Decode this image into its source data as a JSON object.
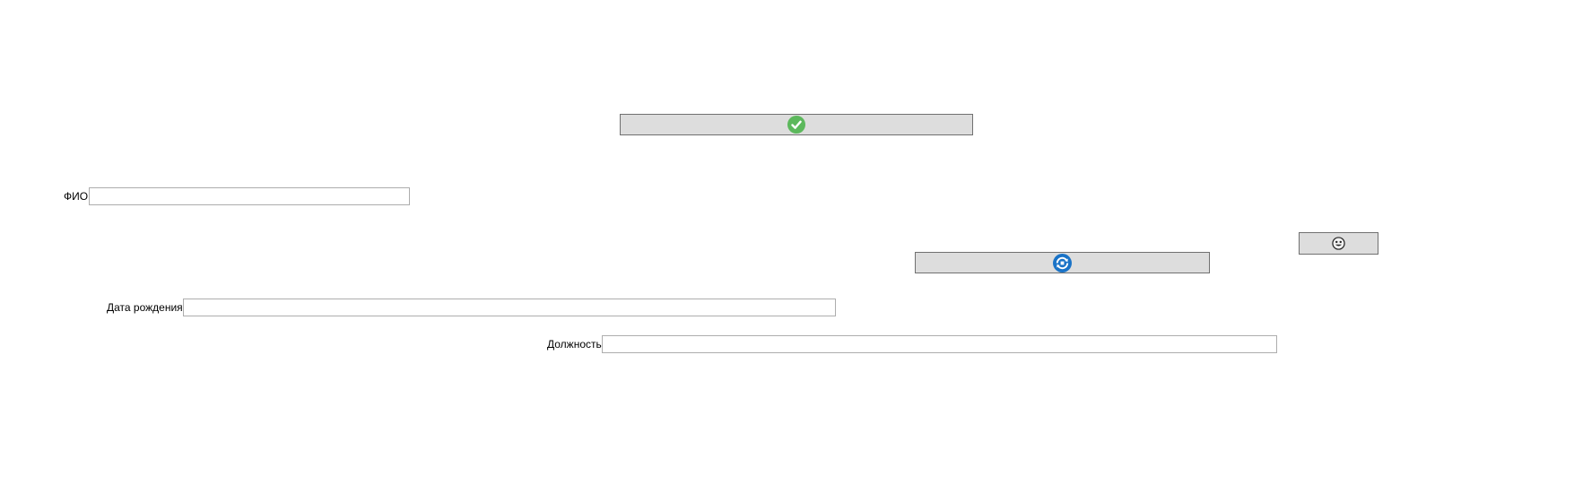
{
  "form": {
    "confirm_button": {
      "icon": "green-check-icon",
      "color": "#5cb85c"
    },
    "refresh_button": {
      "icon": "blue-refresh-icon",
      "color": "#1a73c7"
    },
    "emoji_button": {
      "icon": "smiley-face-icon"
    },
    "fields": {
      "fio": {
        "label": "ФИО",
        "value": ""
      },
      "birth_date": {
        "label": "Дата рождения",
        "value": ""
      },
      "position": {
        "label": "Должность",
        "value": ""
      }
    }
  }
}
